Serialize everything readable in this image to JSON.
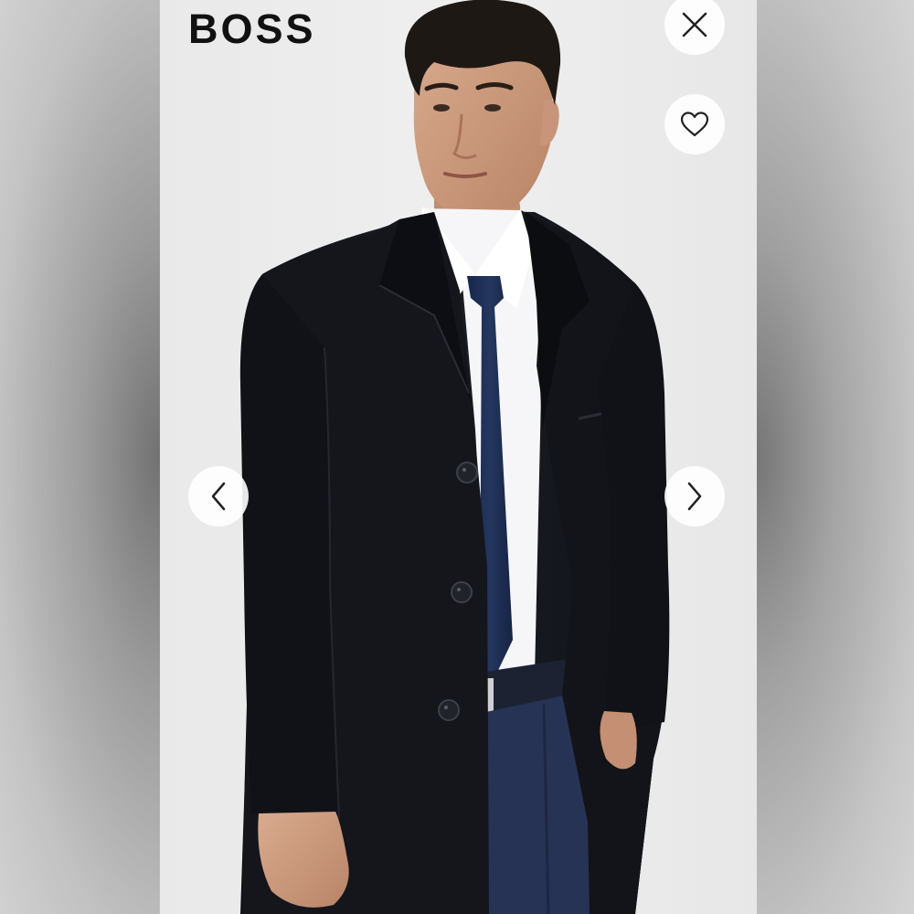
{
  "brand": {
    "name": "BOSS"
  },
  "controls": {
    "close_icon": "close-icon",
    "favorite_icon": "heart-outline-icon",
    "previous_icon": "chevron-left-icon",
    "next_icon": "chevron-right-icon"
  },
  "image": {
    "subject": "product-photo"
  },
  "colors": {
    "background": "#ebebeb",
    "logo": "#111111",
    "button_fill": "#ffffff",
    "icon_stroke": "#222222",
    "coat": "#15171d",
    "shirt": "#f7f7f8",
    "tie": "#1d2d55",
    "trousers": "#2a3657"
  }
}
